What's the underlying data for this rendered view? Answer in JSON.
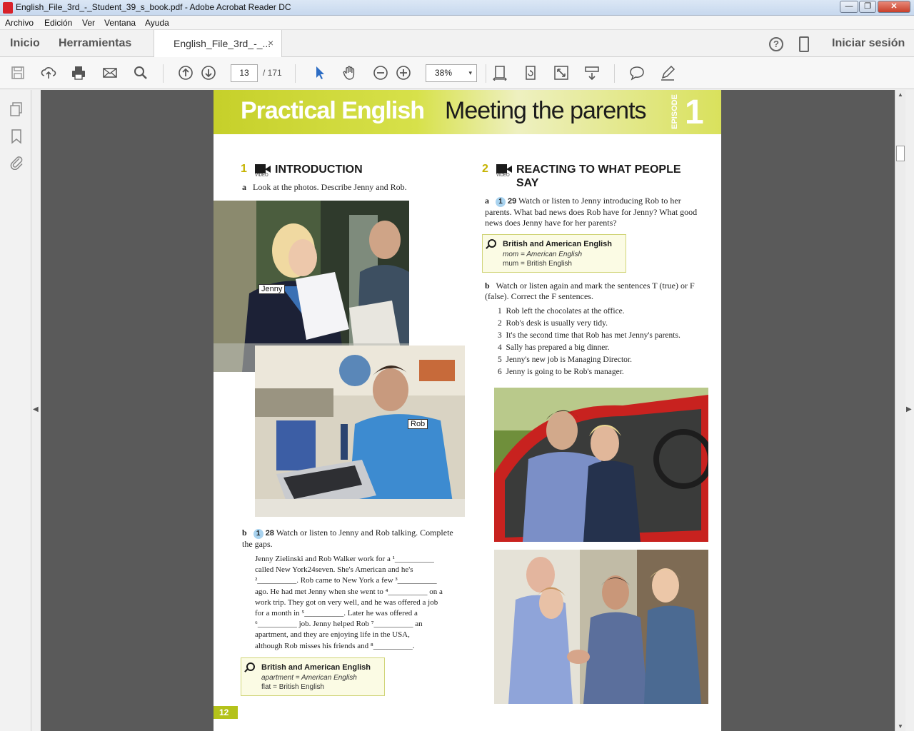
{
  "window": {
    "title": "English_File_3rd_-_Student_39_s_book.pdf - Adobe Acrobat Reader DC",
    "minimize": "—",
    "maximize": "❐",
    "close": "✕"
  },
  "menu": [
    "Archivo",
    "Edición",
    "Ver",
    "Ventana",
    "Ayuda"
  ],
  "tabs": {
    "home": "Inicio",
    "tools": "Herramientas",
    "document": "English_File_3rd_-_...",
    "close": "×",
    "help": "?",
    "mobile": "⇅",
    "signin": "Iniciar sesión"
  },
  "toolbar": {
    "page_current": "13",
    "page_total": "/ 171",
    "zoom": "38%",
    "zoom_caret": "▾",
    "icons": [
      "save-icon",
      "upload-icon",
      "print-icon",
      "email-icon",
      "search-icon",
      "prev-page-icon",
      "next-page-icon",
      "select-cursor-icon",
      "hand-tool-icon",
      "zoom-out-icon",
      "zoom-in-icon",
      "fit-page-icon",
      "rotate-icon",
      "fullscreen-icon",
      "scroll-mode-icon",
      "comment-icon",
      "sign-icon"
    ]
  },
  "rail": {
    "icons": [
      "pages-icon",
      "bookmark-icon",
      "attachment-icon"
    ],
    "left_arrow": "◀",
    "right_arrow": "▶",
    "up": "▲",
    "down": "▼"
  },
  "colors": {
    "banner_green": "#c6d02a",
    "audio_blue": "#a9d3ef",
    "section_number": "#c5b300",
    "viewer_bg": "#5a5a5a"
  },
  "document": {
    "banner": {
      "left": "Practical English",
      "right": "Meeting the parents",
      "episode_label": "EPISODE",
      "episode_number": "1"
    },
    "video_label": "VIDEO",
    "section1": {
      "number": "1",
      "title": "INTRODUCTION",
      "a_label": "a",
      "a_text": "Look at the photos. Describe Jenny and Rob.",
      "label_jenny": "Jenny",
      "label_rob": "Rob",
      "b_label": "b",
      "b_audio": "1",
      "b_track": "28",
      "b_text": "Watch or listen to Jenny and Rob talking. Complete the gaps.",
      "passage": [
        "Jenny Zielinski and Rob Walker work for a ¹__________",
        "called New York24seven. She's American and he's",
        "²__________. Rob came to New York a few ³__________",
        "ago. He had met Jenny when she went to ⁴__________ on a",
        "work trip. They got on very well, and he was offered a job",
        "for a month in ⁵__________. Later he was offered a",
        "⁶__________ job. Jenny helped Rob ⁷__________ an",
        "apartment, and they are enjoying life in the USA,",
        "although Rob misses his friends and ⁸__________."
      ],
      "bae": {
        "title": "British and American English",
        "line1": "apartment = American English",
        "line2": "flat = British English"
      }
    },
    "section2": {
      "number": "2",
      "title_line1": "REACTING TO WHAT PEOPLE",
      "title_line2": "SAY",
      "a_label": "a",
      "a_audio": "1",
      "a_track": "29",
      "a_text": "Watch or listen to Jenny introducing Rob to her parents. What bad news does Rob have for Jenny? What good news does Jenny have for her parents?",
      "bae": {
        "title": "British and American English",
        "line1": "mom = American English",
        "line2": "mum = British English"
      },
      "b_label": "b",
      "b_text": "Watch or listen again and mark the sentences T (true) or F (false). Correct the F sentences.",
      "items": [
        {
          "n": "1",
          "text": "Rob left the chocolates at the office."
        },
        {
          "n": "2",
          "text": "Rob's desk is usually very tidy."
        },
        {
          "n": "3",
          "text": "It's the second time that Rob has met Jenny's parents."
        },
        {
          "n": "4",
          "text": "Sally has prepared a big dinner."
        },
        {
          "n": "5",
          "text": "Jenny's new job is Managing Director."
        },
        {
          "n": "6",
          "text": "Jenny is going to be Rob's manager."
        }
      ]
    },
    "page_number": "12"
  }
}
